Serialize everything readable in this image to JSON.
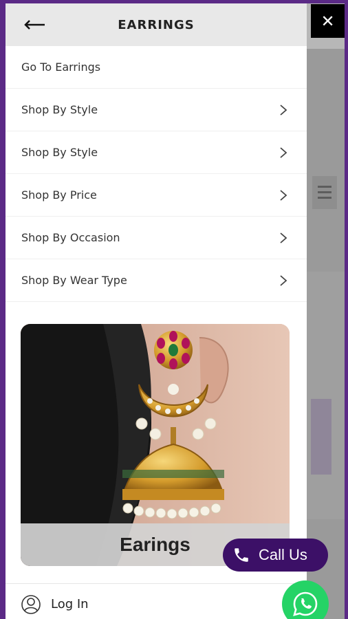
{
  "drawer": {
    "title": "EARRINGS",
    "back_icon": "arrow-left-icon",
    "close_icon": "close-icon",
    "menu_items": [
      {
        "label": "Go To Earrings",
        "chevron": false
      },
      {
        "label": "Shop By Style",
        "chevron": true
      },
      {
        "label": "Shop By Style",
        "chevron": true
      },
      {
        "label": "Shop By Price",
        "chevron": true
      },
      {
        "label": "Shop By Occasion",
        "chevron": true
      },
      {
        "label": "Shop By Wear Type",
        "chevron": true
      }
    ],
    "promo": {
      "caption": "Earings"
    },
    "login": {
      "label": "Log In",
      "icon": "user-icon"
    }
  },
  "floating": {
    "call_label": "Call Us",
    "call_icon": "phone-icon",
    "whatsapp_icon": "whatsapp-icon"
  },
  "colors": {
    "frame": "#5b2a86",
    "call_button": "#3c1067",
    "whatsapp": "#25d366",
    "header_bg": "#e8e8e8"
  }
}
